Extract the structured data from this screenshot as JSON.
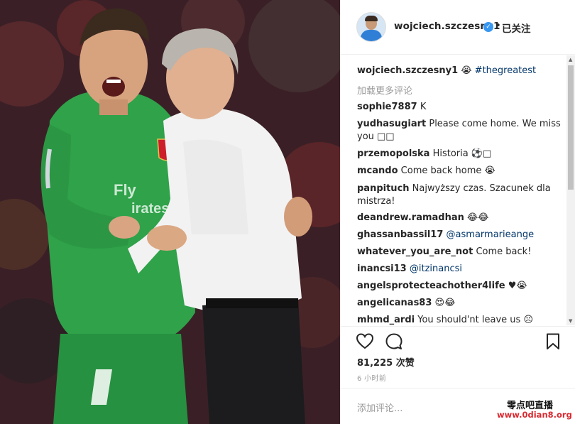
{
  "post": {
    "username": "wojciech.szczesny1",
    "follow_status": "已关注",
    "separator": "•"
  },
  "caption": {
    "username": "wojciech.szczesny1",
    "emoji": "😭",
    "hashtag": "#thegreatest"
  },
  "load_more": "加载更多评论",
  "comments": [
    {
      "username": "sophie7887",
      "text": "K",
      "mention": ""
    },
    {
      "username": "yudhasugiart",
      "text": "Please come home. We miss you □□",
      "mention": ""
    },
    {
      "username": "przemopolska",
      "text": "Historia ⚽□",
      "mention": ""
    },
    {
      "username": "mcando",
      "text": "Come back home 😭",
      "mention": ""
    },
    {
      "username": "panpituch",
      "text": "Najwyższy czas. Szacunek dla mistrza!",
      "mention": ""
    },
    {
      "username": "deandrew.ramadhan",
      "text": "😂😂",
      "mention": ""
    },
    {
      "username": "ghassanbassil17",
      "text": "",
      "mention": "@asmarmarieange"
    },
    {
      "username": "whatever_you_are_not",
      "text": "Come back!",
      "mention": ""
    },
    {
      "username": "inancsi13",
      "text": "",
      "mention": "@itzinancsi"
    },
    {
      "username": "angelsprotecteachother4life",
      "text": "♥😭",
      "mention": ""
    },
    {
      "username": "angelicanas83",
      "text": "😍😂",
      "mention": ""
    },
    {
      "username": "mhmd_ardi",
      "text": "You should'nt leave us ☹",
      "mention": ""
    }
  ],
  "likes": "81,225 次赞",
  "time": "6 小时前",
  "add_comment_placeholder": "添加评论...",
  "watermark": {
    "line1": "零点吧直播",
    "line2": "www.0dian8.org"
  },
  "icons": {
    "like": "heart-icon",
    "comment": "comment-bubble-icon",
    "save": "bookmark-icon",
    "verified": "verified-badge-icon"
  },
  "photo": {
    "jersey_sponsor": "Fly Emirates",
    "jersey_number": "1",
    "club_crest": "Arsenal"
  },
  "colors": {
    "link": "#003569",
    "verified": "#3897f0",
    "muted": "#999999",
    "text": "#262626"
  }
}
